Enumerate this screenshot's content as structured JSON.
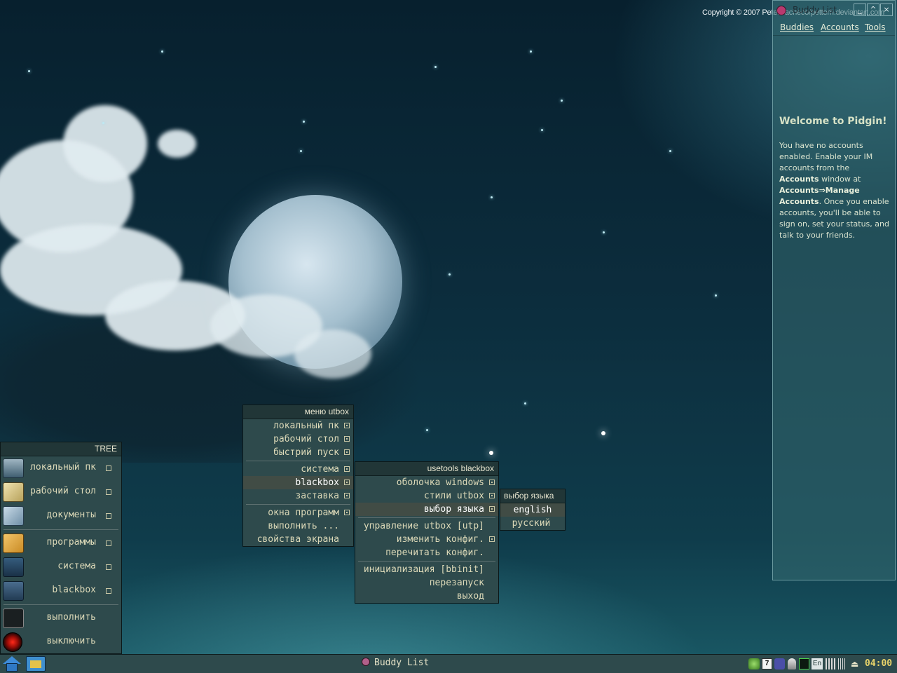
{
  "desktop": {
    "copyright": "Copyright © 2007 PeterPacheco/petterh.deviantart.com"
  },
  "utbox_menu": {
    "title": "меню utbox",
    "items": [
      {
        "label": "локальный пк"
      },
      {
        "label": "рабочий стол"
      },
      {
        "label": "быстрий пуск"
      },
      {
        "label": "система"
      },
      {
        "label": "blackbox"
      },
      {
        "label": "заставка"
      },
      {
        "label": "окна программ"
      },
      {
        "label": "выполнить ..."
      },
      {
        "label": "свойства экрана"
      }
    ]
  },
  "blackbox_menu": {
    "title": "usetools blackbox",
    "items": [
      {
        "label": "оболочка windows"
      },
      {
        "label": "стили utbox"
      },
      {
        "label": "выбор языка"
      },
      {
        "label": "управление utbox [utp]"
      },
      {
        "label": "изменить конфиг."
      },
      {
        "label": "перечитать конфиг."
      },
      {
        "label": "инициализация [bbinit]"
      },
      {
        "label": "перезапуск"
      },
      {
        "label": "выход"
      }
    ]
  },
  "language_menu": {
    "title": "выбор языка",
    "items": [
      {
        "label": "english"
      },
      {
        "label": "русский"
      }
    ]
  },
  "tree": {
    "title": "TREE",
    "items": [
      {
        "label": "локальный пк",
        "icon": "computer-icon"
      },
      {
        "label": "рабочий стол",
        "icon": "desktop-icon"
      },
      {
        "label": "документы",
        "icon": "documents-icon"
      },
      {
        "label": "программы",
        "icon": "programs-icon"
      },
      {
        "label": "система",
        "icon": "system-monitor-icon"
      },
      {
        "label": "blackbox",
        "icon": "floppy-icon"
      },
      {
        "label": "выполнить",
        "icon": "terminal-icon"
      },
      {
        "label": "выключить",
        "icon": "power-icon"
      }
    ]
  },
  "pidgin": {
    "title": "Buddy List",
    "menu": [
      "Buddies",
      "Accounts",
      "Tools"
    ],
    "welcome": "Welcome to Pidgin!",
    "body": {
      "p1": "You have no accounts enabled. Enable your IM accounts from the ",
      "b1": "Accounts",
      "p2": " window at ",
      "b2": "Accounts⇒Manage Accounts",
      "p3": ". Once you enable accounts, you'll be able to sign on, set your status, and talk to your friends."
    }
  },
  "taskbar": {
    "task_label": "Buddy List",
    "lang": "En",
    "tray_badge": "7",
    "clock": "04:00"
  }
}
